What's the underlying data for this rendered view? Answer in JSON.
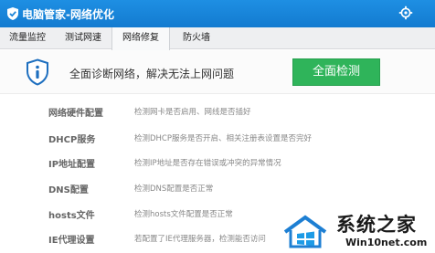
{
  "window": {
    "title": "电脑管家-网络优化",
    "logo_icon": "shield-logo-icon",
    "settings_icon": "settings-icon"
  },
  "tabs": [
    {
      "label": "流量监控",
      "active": false
    },
    {
      "label": "测试网速",
      "active": false
    },
    {
      "label": "网络修复",
      "active": true
    },
    {
      "label": "防火墙",
      "active": false
    }
  ],
  "banner": {
    "icon": "info-shield-icon",
    "headline": "全面诊断网络，解决无法上网问题",
    "button_label": "全面检测",
    "button_color": "#2fb45a"
  },
  "checks": [
    {
      "name": "网络硬件配置",
      "desc": "检测网卡是否启用、网线是否插好"
    },
    {
      "name": "DHCP服务",
      "desc": "检测DHCP服务是否开启、相关注册表设置是否完好"
    },
    {
      "name": "IP地址配置",
      "desc": "检测IP地址是否存在错误或冲突的异常情况"
    },
    {
      "name": "DNS配置",
      "desc": "检测DNS配置是否正常"
    },
    {
      "name": "hosts文件",
      "desc": "检测hosts文件配置是否正常"
    },
    {
      "name": "IE代理设置",
      "desc": "若配置了IE代理服务器，检测能否访问"
    }
  ],
  "watermark": {
    "brand": "系统之家",
    "url": "Win10net.com"
  }
}
